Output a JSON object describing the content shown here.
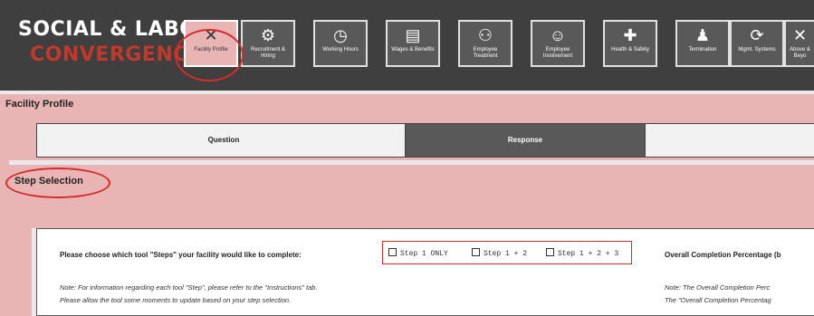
{
  "logo": {
    "line1": "SOCIAL & LABOR",
    "line2": "CONVERGENCE"
  },
  "tabs": [
    {
      "label": "Facility Profile",
      "icon": "facility-icon",
      "glyph": "✕"
    },
    {
      "label": "Recruitment & Hiring",
      "icon": "hiring-icon",
      "glyph": "⚙"
    },
    {
      "label": "Working Hours",
      "icon": "clock-icon",
      "glyph": "◷"
    },
    {
      "label": "Wages & Benefits",
      "icon": "money-icon",
      "glyph": "▤"
    },
    {
      "label": "Employee Treatment",
      "icon": "people-icon",
      "glyph": "⚇"
    },
    {
      "label": "Employee Involvement",
      "icon": "group-icon",
      "glyph": "☺"
    },
    {
      "label": "Health & Safety",
      "icon": "first-aid-icon",
      "glyph": "✚"
    },
    {
      "label": "Termination",
      "icon": "walking-icon",
      "glyph": "♟"
    },
    {
      "label": "Mgmt. Systems",
      "icon": "cycle-icon",
      "glyph": "⟳"
    },
    {
      "label": "Above & Beyo",
      "icon": "above-icon",
      "glyph": "✕"
    }
  ],
  "section_title": "Facility Profile",
  "table_header": {
    "question": "Question",
    "response": "Response"
  },
  "step_selection": "Step Selection",
  "choose_label": "Please choose which tool  \"Steps\" your facility would like to complete:",
  "step_options": [
    "Step 1 ONLY",
    "Step 1 + 2",
    "Step 1 + 2 + 3"
  ],
  "overall_label": "Overall Completion Percentage (b",
  "note1": "Note: For information regarding each tool \"Step\", please refer to the \"Instructions\" tab.",
  "note2": "Please allow the tool some moments to update based on your step selection.",
  "note3": "Note: The Overall Completion Perc",
  "note4": "The \"Overall Completion Percentag",
  "colors": {
    "pink": "#e8b4b4",
    "dark": "#3f3f3f",
    "red": "#c0392b"
  }
}
